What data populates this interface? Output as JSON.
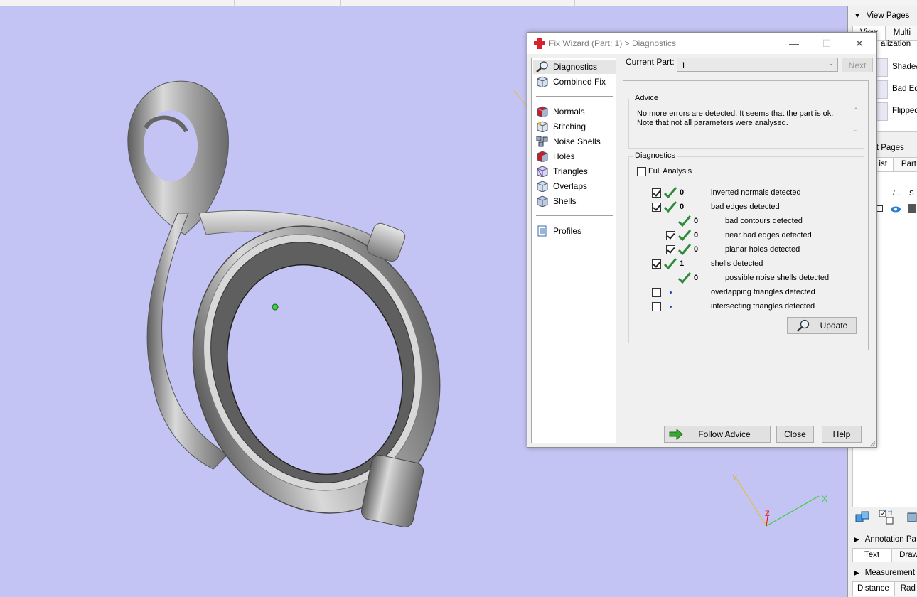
{
  "dialog": {
    "title": "Fix Wizard (Part: 1) > Diagnostics",
    "nav": [
      {
        "label": "Diagnostics",
        "icon": "magnifier-icon"
      },
      {
        "label": "Combined Fix",
        "icon": "cube-fix-icon"
      },
      {
        "label": "Normals",
        "icon": "normals-icon"
      },
      {
        "label": "Stitching",
        "icon": "stitching-icon"
      },
      {
        "label": "Noise Shells",
        "icon": "noise-shells-icon"
      },
      {
        "label": "Holes",
        "icon": "holes-icon"
      },
      {
        "label": "Triangles",
        "icon": "triangles-icon"
      },
      {
        "label": "Overlaps",
        "icon": "overlaps-icon"
      },
      {
        "label": "Shells",
        "icon": "shells-icon"
      },
      {
        "label": "Profiles",
        "icon": "profiles-icon"
      }
    ],
    "current_part_label": "Current Part:",
    "current_part_value": "1",
    "next_label": "Next",
    "advice_legend": "Advice",
    "advice_text": "No more errors are detected. It seems that the part is ok. Note that not all parameters were analysed.",
    "diagnostics_legend": "Diagnostics",
    "full_analysis_label": "Full Analysis",
    "full_analysis_checked": false,
    "rows": [
      {
        "checkbox": true,
        "checked": true,
        "status": "ok",
        "count": "0",
        "label": "inverted normals detected",
        "level": 0
      },
      {
        "checkbox": true,
        "checked": true,
        "status": "ok",
        "count": "0",
        "label": "bad edges detected",
        "level": 0
      },
      {
        "checkbox": false,
        "checked": false,
        "status": "ok",
        "count": "0",
        "label": "bad contours detected",
        "level": 1
      },
      {
        "checkbox": true,
        "checked": true,
        "status": "ok",
        "count": "0",
        "label": "near bad edges detected",
        "level": 1
      },
      {
        "checkbox": true,
        "checked": true,
        "status": "ok",
        "count": "0",
        "label": "planar holes detected",
        "level": 1
      },
      {
        "checkbox": true,
        "checked": true,
        "status": "ok",
        "count": "1",
        "label": "shells detected",
        "level": 0
      },
      {
        "checkbox": false,
        "checked": false,
        "status": "ok",
        "count": "0",
        "label": "possible noise shells detected",
        "level": 1
      },
      {
        "checkbox": true,
        "checked": false,
        "status": "pending",
        "count": "",
        "label": "overlapping triangles detected",
        "level": 0
      },
      {
        "checkbox": true,
        "checked": false,
        "status": "pending",
        "count": "",
        "label": "intersecting triangles detected",
        "level": 0
      }
    ],
    "update_label": "Update",
    "follow_advice_label": "Follow Advice",
    "close_label": "Close",
    "help_label": "Help"
  },
  "right_panel": {
    "view_pages": "View Pages",
    "view_tab": "View",
    "multi_tab": "Multi",
    "visualization": "alization",
    "shade_label": "Shade&",
    "bad_edges_label": "Bad Edg",
    "flipped_label": "Flipped",
    "part_pages": "rt Pages",
    "list_tab": "List",
    "part_tab": "Part",
    "col1": "/...",
    "col2": "S",
    "annotation_pages": "Annotation Pa",
    "text_tab": "Text",
    "drawing_tab": "Drawi",
    "measurement": "Measurement",
    "distance_tab": "Distance",
    "radius_tab": "Rad"
  },
  "axes": {
    "x_label": "X",
    "y_label": "Y",
    "z_label": "Z"
  },
  "colors": {
    "viewport_bg": "#c4c4f4",
    "ok_check": "#2e8b3a",
    "pending_dot": "#1f3fbf",
    "follow_arrow": "#3aa830"
  }
}
